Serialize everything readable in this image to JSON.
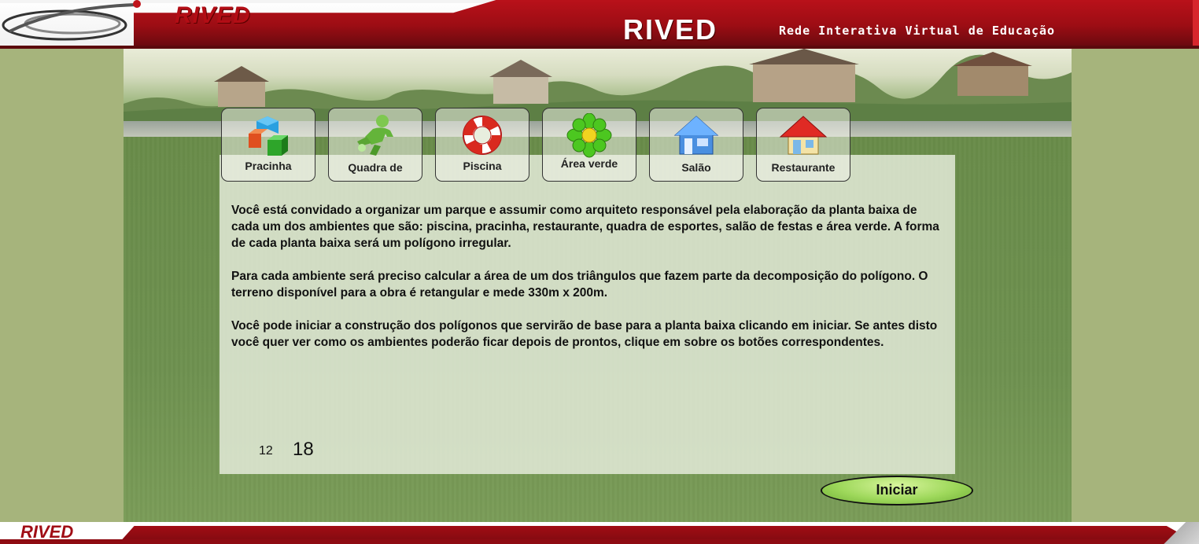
{
  "header": {
    "logo_small": "RIVED",
    "brand": "RIVED",
    "tagline": "Rede Interativa Virtual de Educação"
  },
  "buttons": [
    {
      "label": "Pracinha",
      "icon": "cubes-icon"
    },
    {
      "label": "Quadra de",
      "icon": "player-icon"
    },
    {
      "label": "Piscina",
      "icon": "lifebuoy-icon"
    },
    {
      "label": "Área verde",
      "icon": "flower-icon"
    },
    {
      "label": "Salão",
      "icon": "blue-house-icon"
    },
    {
      "label": "Restaurante",
      "icon": "red-roof-house-icon"
    }
  ],
  "content": {
    "paragraph1": " Você está convidado a organizar um parque e assumir como  arquiteto responsável pela elaboração da planta baixa  de cada um dos ambientes que são: piscina, pracinha, restaurante, quadra de esportes, salão de festas e área verde. A forma de cada planta baixa será um polígono irregular.",
    "paragraph2": "Para cada ambiente será preciso calcular a área de um dos triângulos que fazem parte da decomposição do polígono.  O terreno disponível para a obra é retangular e mede 330m x 200m.",
    "paragraph3": "Você pode iniciar a construção dos polígonos que servirão de base para a planta baixa clicando  em iniciar. Se antes disto você quer ver como os ambientes poderão  ficar depois de prontos, clique em sobre os botões correspondentes.",
    "counter_small": "12",
    "counter_big": "18"
  },
  "start_button": "Iniciar",
  "footer": {
    "logo": "RIVED"
  },
  "colors": {
    "brand_red": "#b30d15",
    "grass": "#6e9150",
    "button_green": "#9ed85b"
  }
}
